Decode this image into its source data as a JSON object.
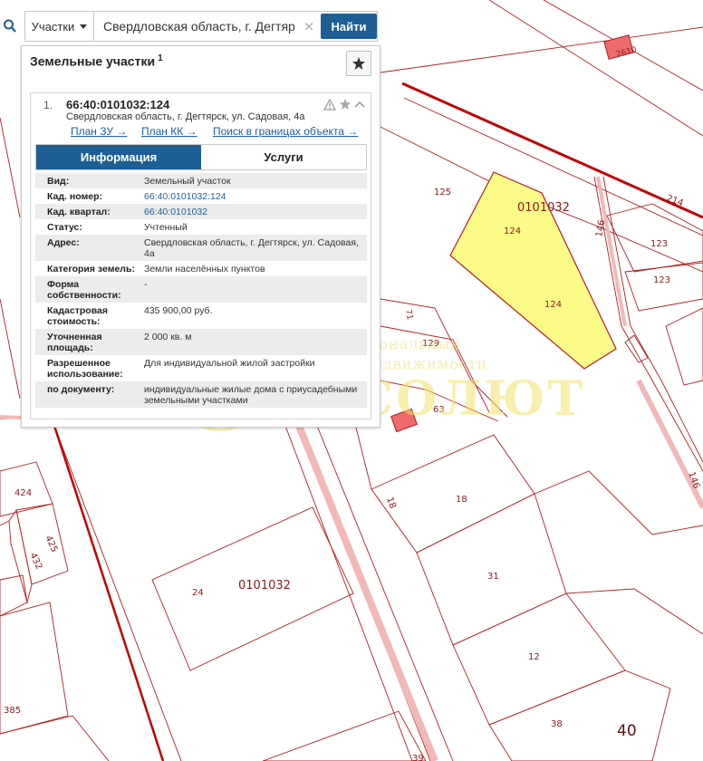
{
  "search": {
    "mode_label": "Участки",
    "query": "Свердловская область, г. Дегтяр",
    "clear_symbol": "×",
    "button_label": "Найти"
  },
  "panel": {
    "title": "Земельные участки",
    "count": "1",
    "result": {
      "index": "1.",
      "cad_number": "66:40:0101032:124",
      "address": "Свердловская область, г. Дегтярск, ул. Садовая, 4а",
      "links": [
        "План ЗУ →",
        "План КК →",
        "Поиск в границах объекта →"
      ],
      "tabs": [
        "Информация",
        "Услуги"
      ],
      "rows": [
        {
          "key": "Вид:",
          "value": "Земельный участок"
        },
        {
          "key": "Кад. номер:",
          "value": "66:40:0101032:124"
        },
        {
          "key": "Кад. квартал:",
          "value": "66:40:0101032"
        },
        {
          "key": "Статус:",
          "value": "Учтенный"
        },
        {
          "key": "Адрес:",
          "value": "Свердловская область, г. Дегтярск, ул. Садовая, 4а"
        },
        {
          "key": "Категория земель:",
          "value": "Земли населённых пунктов"
        },
        {
          "key": "Форма собственности:",
          "value": "-"
        },
        {
          "key": "Кадастровая стоимость:",
          "value": "435 900,00 руб."
        },
        {
          "key": "Уточненная площадь:",
          "value": "2 000 кв. м"
        },
        {
          "key": "Разрешенное использование:",
          "value": "Для индивидуальной жилой застройки"
        },
        {
          "key": "по документу:",
          "value": "индивидуальные жилые дома с приусадебными земельными участками"
        }
      ]
    }
  },
  "map": {
    "labels": {
      "block_top": "0101032",
      "block_bottom": "0101032",
      "p124a": "124",
      "p124b": "124",
      "p125": "125",
      "p129": "129",
      "p214": "214",
      "p146a": "146",
      "p146b": "146",
      "p123a": "123",
      "p123b": "123",
      "p2610": "2610",
      "p71": "71",
      "p63": "63",
      "p18a": "18",
      "p18b": "18",
      "p31": "31",
      "p12": "12",
      "p38": "38",
      "p40": "40",
      "p39": "39",
      "p24": "24",
      "p424": "424",
      "p425": "425",
      "p432": "432",
      "p385": "385"
    },
    "colors": {
      "boundary": "#b02020",
      "road": "#c00000",
      "selected_fill": "#fdfb88",
      "building_fill": "#ef6a6a"
    }
  },
  "watermark": {
    "line1": "Региональный",
    "line2": "центр недвижимости",
    "line3": "АБСОЛЮТ"
  }
}
